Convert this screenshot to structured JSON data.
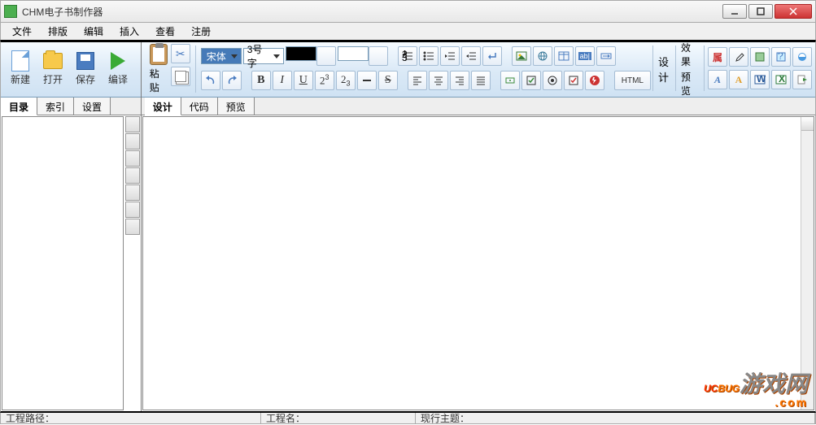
{
  "title": "CHM电子书制作器",
  "menu": [
    "文件",
    "排版",
    "编辑",
    "插入",
    "查看",
    "注册"
  ],
  "main_toolbar": {
    "new": "新建",
    "open": "打开",
    "save": "保存",
    "compile": "编译"
  },
  "paste": {
    "label": "粘贴"
  },
  "font": {
    "name": "宋体",
    "size": "3号字"
  },
  "design_btn": "设计",
  "preview_btn": {
    "l1": "效果",
    "l2": "预览"
  },
  "html_btn": "HTML",
  "prop_btn": "属",
  "left_tabs": [
    "目录",
    "索引",
    "设置"
  ],
  "right_tabs": [
    "设计",
    "代码",
    "预览"
  ],
  "status": {
    "path_label": "工程路径：",
    "name_label": "工程名：",
    "theme_label": "现行主题："
  },
  "watermark": {
    "brand1": "UC",
    "brand2": "BUG",
    "cn": "游戏网",
    "com": ".com"
  },
  "format": {
    "bold": "B",
    "italic": "I",
    "underline": "U",
    "sup": "2",
    "sup_exp": "3",
    "sub": "2",
    "sub_exp": "3",
    "strike": "S"
  }
}
